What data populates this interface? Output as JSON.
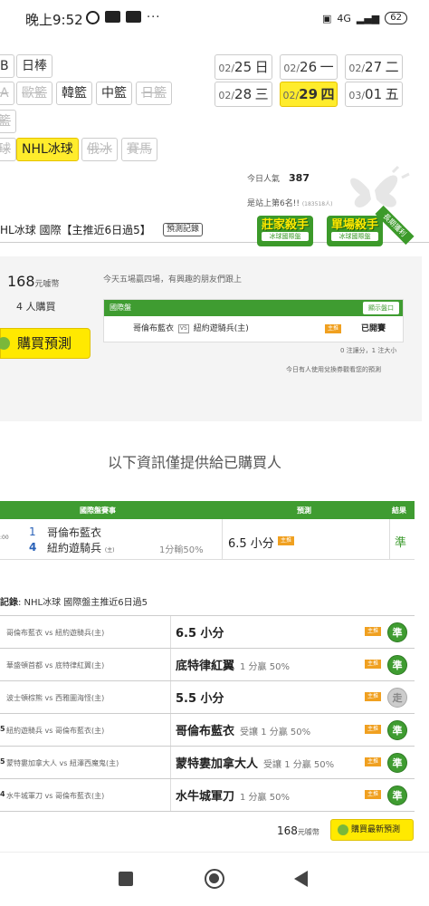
{
  "status_bar": {
    "time": "晚上9:52",
    "dots": "···",
    "network": "4G",
    "battery": "62"
  },
  "sport_tabs": [
    {
      "label": "B",
      "state": "normal"
    },
    {
      "label": "日棒",
      "state": "normal"
    },
    {
      "label": "A",
      "state": "disabled"
    },
    {
      "label": "歐籃",
      "state": "disabled"
    },
    {
      "label": "韓籃",
      "state": "normal"
    },
    {
      "label": "中籃",
      "state": "normal"
    },
    {
      "label": "日籃",
      "state": "disabled"
    },
    {
      "label": "籃",
      "state": "disabled"
    },
    {
      "label": "球",
      "state": "disabled"
    },
    {
      "label": "NHL冰球",
      "state": "active"
    },
    {
      "label": "俄冰",
      "state": "disabled"
    },
    {
      "label": "賽馬",
      "state": "disabled"
    }
  ],
  "dates": [
    {
      "md": "02/",
      "day": "25",
      "wd": "日"
    },
    {
      "md": "02/",
      "day": "26",
      "wd": "一"
    },
    {
      "md": "02/",
      "day": "27",
      "wd": "二"
    },
    {
      "md": "02/",
      "day": "28",
      "wd": "三"
    },
    {
      "md": "02/",
      "day": "29",
      "wd": "四",
      "active": true
    },
    {
      "md": "03/",
      "day": "01",
      "wd": "五"
    }
  ],
  "popularity": {
    "label": "今日人氣",
    "value": "387",
    "rank_text": "是站上第6名!!",
    "rank_sub": "(183518人)"
  },
  "title": {
    "text": "HL冰球 國際【主推近6日過5】",
    "record_btn": "預測記錄"
  },
  "badges": [
    {
      "main": "莊家殺手",
      "sub": "冰球國際盤"
    },
    {
      "main": "單場殺手",
      "sub": "冰球國際盤"
    }
  ],
  "ribbon": "長期獲利",
  "summary": {
    "price": "168",
    "price_unit": "元噱幣",
    "buyers": "4 人購買",
    "buy_btn": "購買預測",
    "note_top": "今天五場贏四場，有興趣的朋友們跟上",
    "box_header": "國際盤",
    "odds_btn": "顯示盤口",
    "match_home": "哥倫布藍衣",
    "vs": "VS",
    "match_away": "紐約遊騎兵(主)",
    "tag": "主推",
    "paid": "已開賽",
    "count": "0 注讓分，1 注大小",
    "note_bottom": "今日有人使用兌換券觀看您的預測"
  },
  "info_line": "以下資訊僅提供給已購買人",
  "pred_table": {
    "headers": {
      "match": "國際盤賽事",
      "pred": "預測",
      "result": "結果"
    },
    "row": {
      "time": ":00",
      "n1": "1",
      "team1": "哥倫布藍衣",
      "n2": "4",
      "team2": "紐約遊騎兵",
      "team2_tag": "(主)",
      "handicap": "1分輸50%",
      "prediction": "6.5 小分",
      "tag": "主推",
      "result": "準"
    }
  },
  "history": {
    "label": "記錄",
    "text": ": NHL冰球 國際盤主推近6日過5",
    "rows": [
      {
        "num": "",
        "match": "哥倫布藍衣 vs 紐約遊騎兵(主)",
        "pick": "6.5 小分",
        "note": "",
        "tag": "主推",
        "result": "準"
      },
      {
        "num": "",
        "match": "華盛頓首都 vs 底特律紅翼(主)",
        "pick": "底特律紅翼",
        "note": "1 分贏 50%",
        "tag": "主推",
        "result": "準"
      },
      {
        "num": "",
        "match": "波士頓棕熊 vs 西雅圖海怪(主)",
        "pick": "5.5 小分",
        "note": "",
        "tag": "主推",
        "result": "走"
      },
      {
        "num": "5",
        "match": "紐約遊騎兵 vs 哥倫布藍衣(主)",
        "pick": "哥倫布藍衣",
        "note": "受讓 1 分贏 50%",
        "tag": "主推",
        "result": "準"
      },
      {
        "num": "5",
        "match": "蒙特婁加拿大人 vs 紐澤西魔鬼(主)",
        "pick": "蒙特婁加拿大人",
        "note": "受讓 1 分贏 50%",
        "tag": "主推",
        "result": "準"
      },
      {
        "num": "4",
        "match": "水牛城軍刀 vs 哥倫布藍衣(主)",
        "pick": "水牛城軍刀",
        "note": "1 分贏 50%",
        "tag": "主推",
        "result": "準"
      }
    ]
  },
  "footer": {
    "price": "168",
    "unit": "元噱幣",
    "btn": "購買最新預測"
  },
  "colors": {
    "accent_green": "#3f9c31",
    "highlight_yellow": "#ffec2c",
    "tag_orange": "#f0a020",
    "team_blue": "#2a62b8"
  }
}
